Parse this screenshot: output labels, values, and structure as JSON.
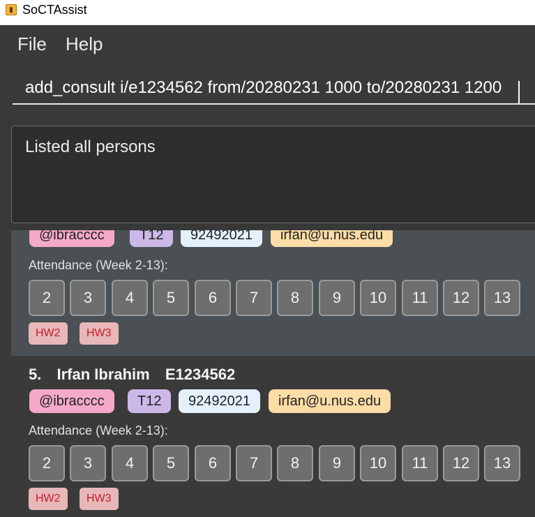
{
  "window": {
    "title": "SoCTAssist"
  },
  "menu": {
    "items": [
      "File",
      "Help"
    ]
  },
  "command": {
    "value": "add_consult i/e1234562 from/20280231 1000 to/20280231 1200"
  },
  "result": {
    "text": "Listed all persons"
  },
  "attendance_label": "Attendance (Week 2-13):",
  "weeks": [
    "2",
    "3",
    "4",
    "5",
    "6",
    "7",
    "8",
    "9",
    "10",
    "11",
    "12",
    "13"
  ],
  "previous_card": {
    "partial_tags": [
      "@ibracccc",
      "T12",
      "92492021",
      "irfan@u.nus.edu"
    ],
    "homework": [
      "HW2",
      "HW3"
    ]
  },
  "current_card": {
    "index": "5.",
    "name": "Irfan Ibrahim",
    "student_id": "E1234562",
    "telegram": "@ibracccc",
    "tutorial": "T12",
    "phone": "92492021",
    "email": "irfan@u.nus.edu",
    "homework": [
      "HW2",
      "HW3"
    ]
  },
  "colors": {
    "background": "#3a3a3a",
    "selected_card": "#4a5054",
    "telegram_tag": "#f4a9c8",
    "tutorial_tag": "#cbb8e8",
    "phone_tag": "#e4f1fd",
    "email_tag": "#fcdca7",
    "homework_tag": "#e8b7b9",
    "homework_text": "#c21e2b"
  }
}
